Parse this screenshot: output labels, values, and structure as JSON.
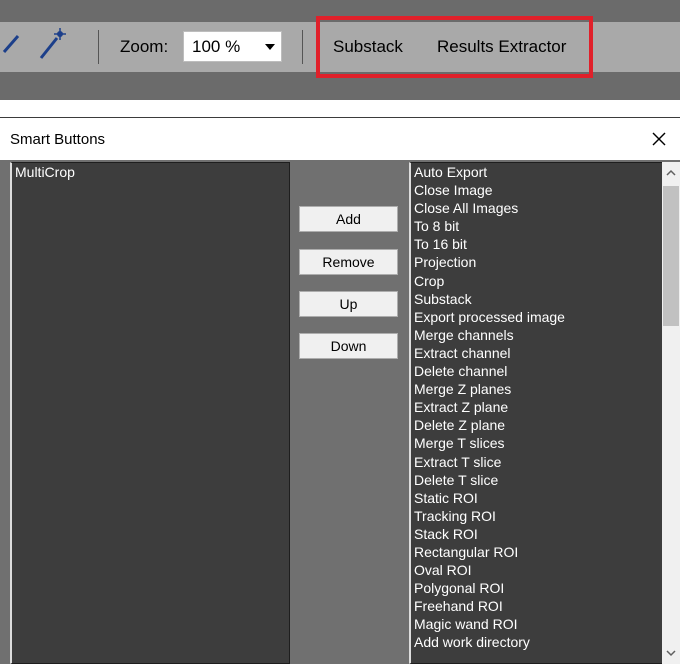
{
  "toolbar": {
    "zoom_label": "Zoom:",
    "zoom_value": "100 %",
    "buttons": [
      {
        "label": "Substack"
      },
      {
        "label": "Results Extractor"
      }
    ],
    "highlight_color": "#e0202a"
  },
  "dialog": {
    "title": "Smart Buttons",
    "active_list": [
      "MultiCrop"
    ],
    "available_list": [
      "Auto Export",
      "Close Image",
      "Close All Images",
      "To 8 bit",
      "To 16 bit",
      "Projection",
      "Crop",
      "Substack",
      "Export processed image",
      "Merge channels",
      "Extract channel",
      "Delete channel",
      "Merge Z planes",
      "Extract Z plane",
      "Delete Z plane",
      "Merge T slices",
      "Extract T slice",
      "Delete T slice",
      "Static ROI",
      "Tracking ROI",
      "Stack ROI",
      "Rectangular ROI",
      "Oval ROI",
      "Polygonal ROI",
      "Freehand ROI",
      "Magic wand ROI",
      "Add work directory"
    ],
    "actions": {
      "add": "Add",
      "remove": "Remove",
      "up": "Up",
      "down": "Down"
    }
  }
}
